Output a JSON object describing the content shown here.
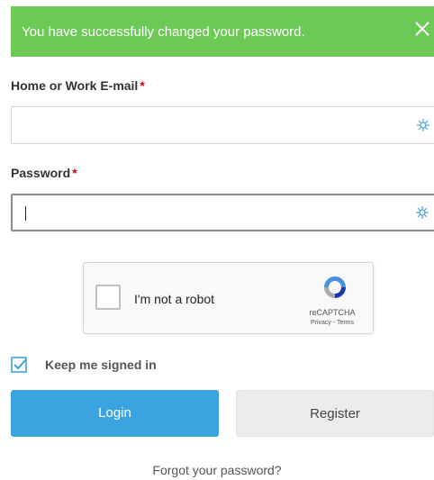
{
  "alert": {
    "message": "You have successfully changed your password.",
    "color": "#6cc955",
    "close_icon": "close-icon"
  },
  "email": {
    "label": "Home or Work E-mail",
    "required_mark": "*",
    "value": "",
    "placeholder": "",
    "icon": "key-icon"
  },
  "password": {
    "label": "Password",
    "required_mark": "*",
    "value": "",
    "placeholder": "",
    "icon": "key-icon"
  },
  "captcha": {
    "checkbox_label": "I'm not a robot",
    "brand": "reCAPTCHA",
    "terms": "Privacy - Terms",
    "checked": false
  },
  "keep_signed_in": {
    "label": "Keep me signed in",
    "checked": true
  },
  "buttons": {
    "login": "Login",
    "register": "Register"
  },
  "forgot_link": "Forgot your password?",
  "colors": {
    "login_button": "#3ba4e0",
    "register_button": "#ececec",
    "required": "#d0021b"
  }
}
